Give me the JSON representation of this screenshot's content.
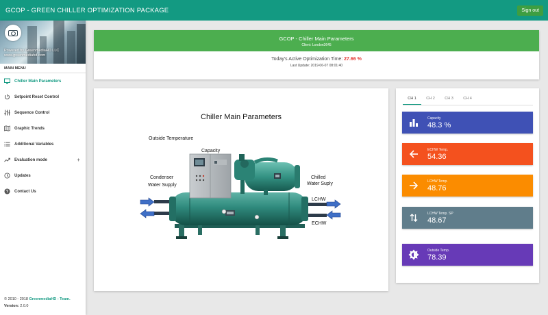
{
  "header": {
    "title": "GCOP - GREEN CHILLER OPTIMIZATION PACKAGE",
    "signout_label": "Sign out"
  },
  "sidebar": {
    "banner_line1": "Powered by GreenmediaHD LLC",
    "banner_line2": "www.greenmediahd.com",
    "menu_header": "MAIN MENU",
    "items": [
      {
        "label": "Chiller Main Parameters",
        "icon": "monitor-icon",
        "active": true
      },
      {
        "label": "Setpoint Reset Control",
        "icon": "power-icon"
      },
      {
        "label": "Sequence Control",
        "icon": "sliders-icon"
      },
      {
        "label": "Graphic Trends",
        "icon": "map-icon"
      },
      {
        "label": "Additional Variables",
        "icon": "list-icon"
      },
      {
        "label": "Evaluation mode",
        "icon": "trending-up-icon",
        "expand": "+"
      },
      {
        "label": "Updates",
        "icon": "history-icon"
      },
      {
        "label": "Contact Us",
        "icon": "help-icon"
      }
    ],
    "footer": {
      "copyright_prefix": "© 2010 - 2018",
      "brand": "GreenmediaHD - Team.",
      "version_label": "Version:",
      "version": "2.0.0"
    }
  },
  "overview": {
    "title": "GCOP - Chiller Main Parameters",
    "client": "Client: London3645",
    "optimization_label": "Today's Active Optimization Time:",
    "optimization_value": "27.66 %",
    "last_update": "Last Update: 2019-06-07 08:01:40"
  },
  "diagram": {
    "title": "Chiller Main Parameters",
    "labels": {
      "outside_temp": "Outside Temperature",
      "capacity": "Capacity",
      "condenser_1": "Condenser",
      "condenser_2": "Water Supply",
      "chilled_1": "Chilled",
      "chilled_2": "Water Suply",
      "lchw": "LCHW",
      "echw": "ECHW"
    }
  },
  "panel": {
    "tabs": [
      "CH 1",
      "CH 2",
      "CH 3",
      "CH 4"
    ],
    "active_tab": 0,
    "stats": [
      {
        "label": "Capacity",
        "value": "48.3 %",
        "color": "#3f51b5",
        "icon": "bar-chart-icon"
      },
      {
        "label": "ECHW Temp.",
        "value": "54.36",
        "color": "#f4511e",
        "icon": "arrow-left-icon"
      },
      {
        "label": "LCHW Temp.",
        "value": "48.76",
        "color": "#fb8c00",
        "icon": "arrow-right-icon"
      },
      {
        "label": "LCHW Temp. SP",
        "value": "48.67",
        "color": "#607d8b",
        "icon": "swap-vertical-icon"
      },
      {
        "label": "Outside Temp.",
        "value": "78.39",
        "color": "#673ab7",
        "icon": "brightness-icon"
      }
    ]
  }
}
